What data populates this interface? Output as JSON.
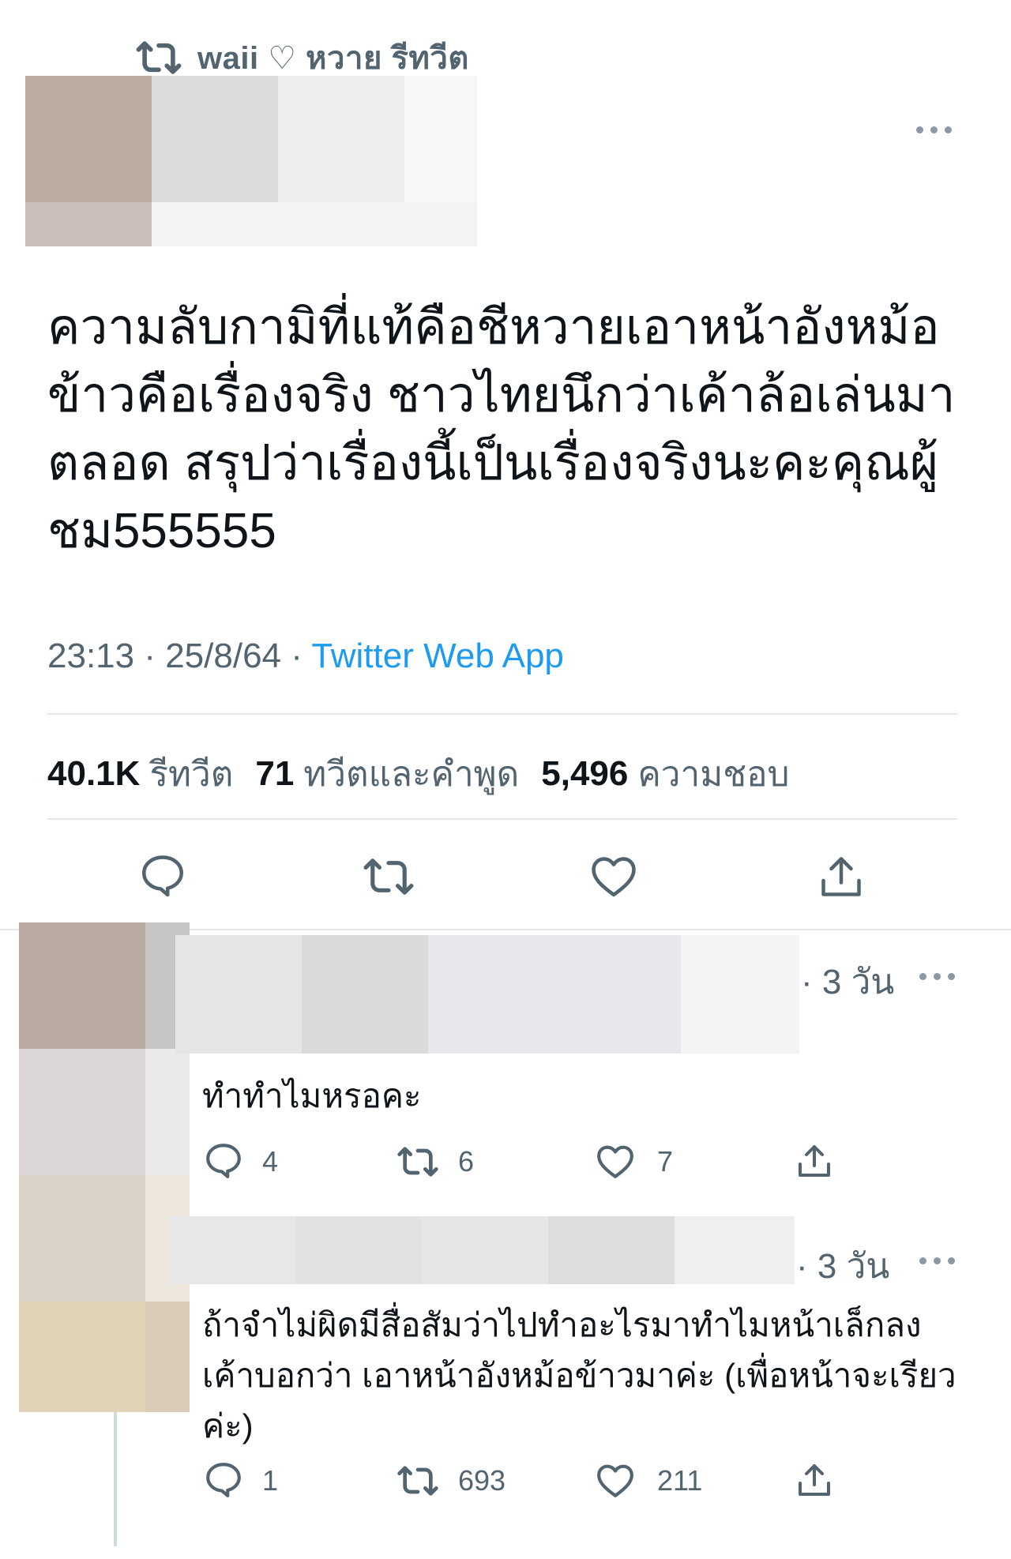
{
  "retweet_header": {
    "icon": "retweet-icon",
    "text": "waii ♡ หวาย รีทวีต"
  },
  "main_tweet": {
    "text": "ความลับกามิที่แท้คือชีหวายเอาหน้าอังหม้อข้าวคือเรื่องจริง ชาวไทยนึกว่าเค้าล้อเล่นมาตลอด สรุปว่าเรื่องนี้เป็นเรื่องจริงนะคะคุณผู้ชม555555",
    "time": "23:13 · 25/8/64 · ",
    "source": "Twitter Web App",
    "stats": {
      "retweets_value": "40.1K",
      "retweets_label": "รีทวีต",
      "quotes_value": "71",
      "quotes_label": "ทวีตและคำพูด",
      "likes_value": "5,496",
      "likes_label": "ความชอบ"
    },
    "actions": [
      "reply-icon",
      "retweet-icon",
      "like-icon",
      "share-icon"
    ]
  },
  "replies": [
    {
      "time": "· 3 วัน",
      "text": "ทำทำไมหรอคะ",
      "reply_count": "4",
      "retweet_count": "6",
      "like_count": "7"
    },
    {
      "time": "· 3 วัน",
      "text": "ถ้าจำไม่ผิดมีสื่อสัมว่าไปทำอะไรมาทำไมหน้าเล็กลง เค้าบอกว่า เอาหน้าอังหม้อข้าวมาค่ะ (เพื่อหน้าจะเรียวค่ะ)",
      "reply_count": "1",
      "retweet_count": "693",
      "like_count": "211"
    }
  ],
  "colors": {
    "text": "#0f1419",
    "muted": "#536471",
    "link": "#1d9bf0",
    "divider": "#e1e6ea"
  }
}
